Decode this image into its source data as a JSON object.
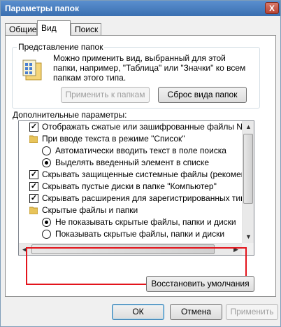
{
  "window": {
    "title": "Параметры папок",
    "close_label": "X"
  },
  "tabs": [
    {
      "label": "Общие",
      "active": false
    },
    {
      "label": "Вид",
      "active": true
    },
    {
      "label": "Поиск",
      "active": false
    }
  ],
  "folder_view": {
    "group_label": "Представление папок",
    "description": "Можно применить вид, выбранный для этой папки, например, \"Таблица\" или \"Значки\" ко всем папкам этого типа.",
    "apply_button": "Применить к папкам",
    "reset_button": "Сброс вида папок"
  },
  "advanced": {
    "label": "Дополнительные параметры:",
    "items": [
      {
        "type": "checkbox",
        "checked": true,
        "text": "Отображать сжатые или зашифрованные файлы NT"
      },
      {
        "type": "folder",
        "text": "При вводе текста в режиме \"Список\""
      },
      {
        "type": "radio",
        "checked": false,
        "text": "Автоматически вводить текст в поле поиска"
      },
      {
        "type": "radio",
        "checked": true,
        "text": "Выделять введенный элемент в списке"
      },
      {
        "type": "checkbox",
        "checked": true,
        "text": "Скрывать защищенные системные файлы (рекомен"
      },
      {
        "type": "checkbox",
        "checked": true,
        "text": "Скрывать пустые диски в папке \"Компьютер\""
      },
      {
        "type": "checkbox",
        "checked": true,
        "text": "Скрывать расширения для зарегистрированных типо"
      },
      {
        "type": "folder",
        "text": "Скрытые файлы и папки"
      },
      {
        "type": "radio",
        "checked": true,
        "text": "Не показывать скрытые файлы, папки и диски"
      },
      {
        "type": "radio",
        "checked": false,
        "text": "Показывать скрытые файлы, папки и диски"
      }
    ],
    "restore_button": "Восстановить умолчания"
  },
  "footer": {
    "ok": "ОК",
    "cancel": "Отмена",
    "apply": "Применить"
  },
  "colors": {
    "highlight_border": "#e3141c",
    "title_bar": "#3a6fb0"
  }
}
